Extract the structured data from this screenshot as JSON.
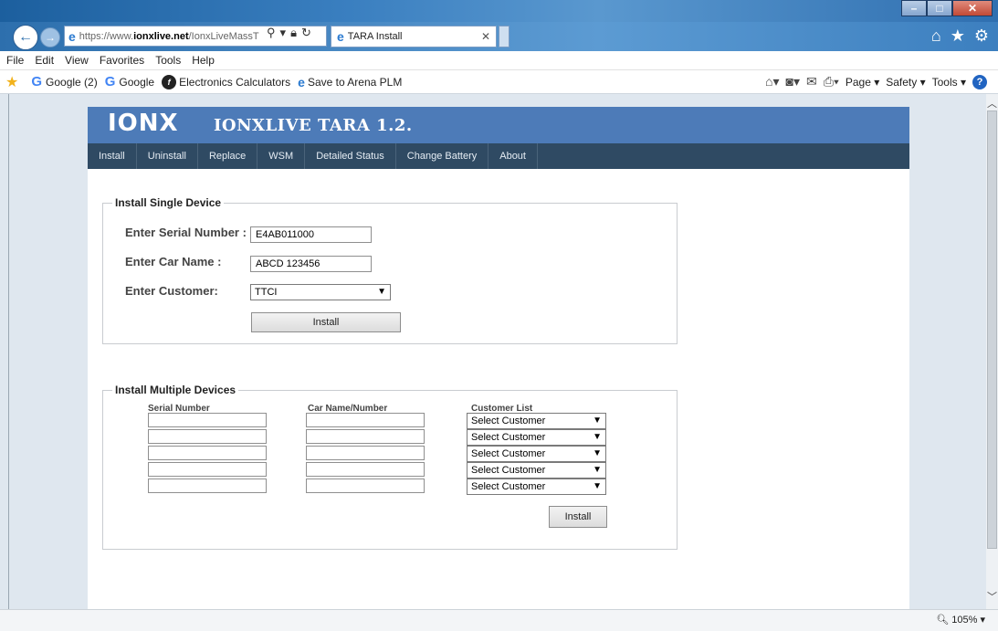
{
  "browser": {
    "url_scheme": "https://www.",
    "url_domain": "ionxlive.net",
    "url_path": "/IonxLiveMassT",
    "tab_title": "TARA Install",
    "menu": [
      "File",
      "Edit",
      "View",
      "Favorites",
      "Tools",
      "Help"
    ],
    "favorites": [
      {
        "label": "Google (2)"
      },
      {
        "label": "Google"
      },
      {
        "label": "Electronics Calculators"
      },
      {
        "label": "Save to Arena PLM"
      }
    ],
    "command_bar": {
      "page": "Page ▾",
      "safety": "Safety ▾",
      "tools": "Tools ▾"
    },
    "zoom": "105%"
  },
  "app": {
    "logo": "IONX",
    "title": "IONXLIVE TARA  1.2.",
    "nav": [
      "Install",
      "Uninstall",
      "Replace",
      "WSM",
      "Detailed Status",
      "Change Battery",
      "About"
    ]
  },
  "single": {
    "legend": "Install Single Device",
    "serial_label": "Enter Serial Number :",
    "serial_value": "E4AB011000",
    "car_label": "Enter Car Name :",
    "car_value": "ABCD 123456",
    "customer_label": "Enter Customer:",
    "customer_value": "TTCI",
    "install_label": "Install"
  },
  "multiple": {
    "legend": "Install Multiple Devices",
    "col_serial": "Serial Number",
    "col_car": "Car Name/Number",
    "col_customer": "Customer List",
    "rows": [
      {
        "serial": "",
        "car": "",
        "customer": "Select Customer"
      },
      {
        "serial": "",
        "car": "",
        "customer": "Select Customer"
      },
      {
        "serial": "",
        "car": "",
        "customer": "Select Customer"
      },
      {
        "serial": "",
        "car": "",
        "customer": "Select Customer"
      },
      {
        "serial": "",
        "car": "",
        "customer": "Select Customer"
      }
    ],
    "install_label": "Install"
  }
}
